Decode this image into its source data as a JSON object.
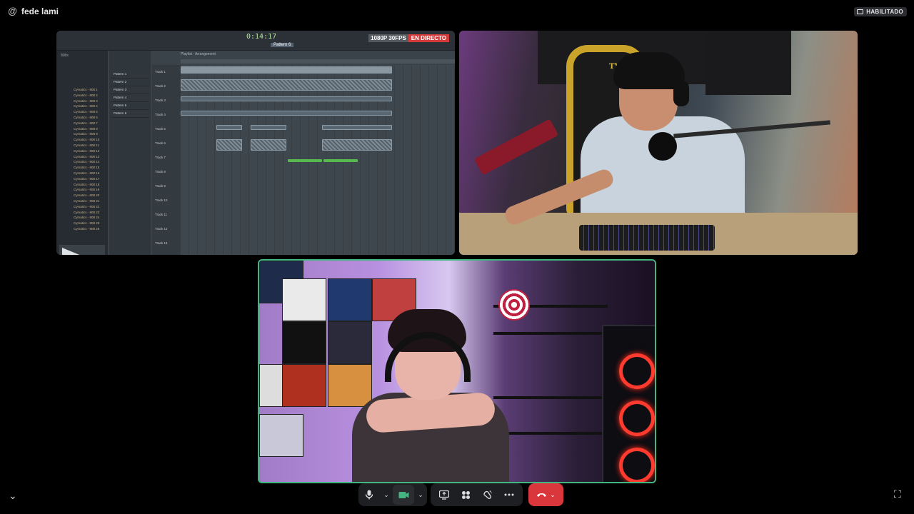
{
  "header": {
    "at_symbol": "@",
    "channel_name": "fede lami",
    "status_badge": "HABILITADO"
  },
  "screen_share": {
    "stream_quality": "1080P 30FPS",
    "live_label": "EN DIRECTO",
    "daw_time": "0:14:17",
    "pattern_label": "Pattern 6",
    "browser_title": "808s",
    "playlist_title": "Playlist - Arrangement",
    "channels": [
      "Pattern 1",
      "Pattern 2",
      "Pattern 3",
      "Pattern 4",
      "Pattern 5",
      "Pattern 6"
    ],
    "browser_items": [
      "Cymatics - 808 1",
      "Cymatics - 808 2",
      "Cymatics - 808 3",
      "Cymatics - 808 4",
      "Cymatics - 808 5",
      "Cymatics - 808 6",
      "Cymatics - 808 7",
      "Cymatics - 808 8",
      "Cymatics - 808 9",
      "Cymatics - 808 10",
      "Cymatics - 808 11",
      "Cymatics - 808 12",
      "Cymatics - 808 13",
      "Cymatics - 808 14",
      "Cymatics - 808 15",
      "Cymatics - 808 16",
      "Cymatics - 808 17",
      "Cymatics - 808 18",
      "Cymatics - 808 19",
      "Cymatics - 808 20",
      "Cymatics - 808 21",
      "Cymatics - 808 22",
      "Cymatics - 808 23",
      "Cymatics - 808 24",
      "Cymatics - 808 25",
      "Cymatics - 808 26"
    ],
    "tracks": [
      "Track 1",
      "Track 2",
      "Track 3",
      "Track 4",
      "Track 5",
      "Track 6",
      "Track 7",
      "Track 8",
      "Track 9",
      "Track 10",
      "Track 11",
      "Track 12",
      "Track 13"
    ]
  },
  "webcam_1": {
    "chair_brand": "TYPHON"
  },
  "controls": {
    "microphone_icon": "microphone-icon",
    "camera_icon": "camera-icon",
    "share_screen_icon": "share-screen-icon",
    "activities_icon": "activities-icon",
    "soundboard_icon": "soundboard-icon",
    "more_icon": "more-icon",
    "hangup_icon": "hangup-icon"
  },
  "colors": {
    "speaking_border": "#43b581",
    "hangup": "#da373c",
    "live_badge": "#d73a3a"
  }
}
